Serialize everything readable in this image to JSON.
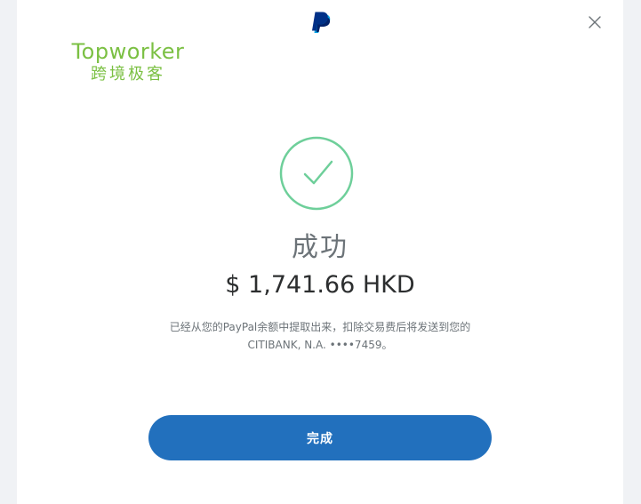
{
  "watermark": {
    "title": "Topworker",
    "subtitle": "跨境极客"
  },
  "icons": {
    "logo": "paypal-logo-icon",
    "close": "close-icon",
    "status": "success-check-icon"
  },
  "colors": {
    "success": "#6ecf9a",
    "primary_button": "#2270bd",
    "watermark": "#7bc043"
  },
  "status": {
    "title": "成功",
    "amount": "$ 1,741.66 HKD"
  },
  "message": {
    "line1": "已经从您的PayPal余额中提取出来，扣除交易费后将发送到您的",
    "line2": "CITIBANK, N.A. ••••7459。"
  },
  "actions": {
    "done_label": "完成"
  }
}
